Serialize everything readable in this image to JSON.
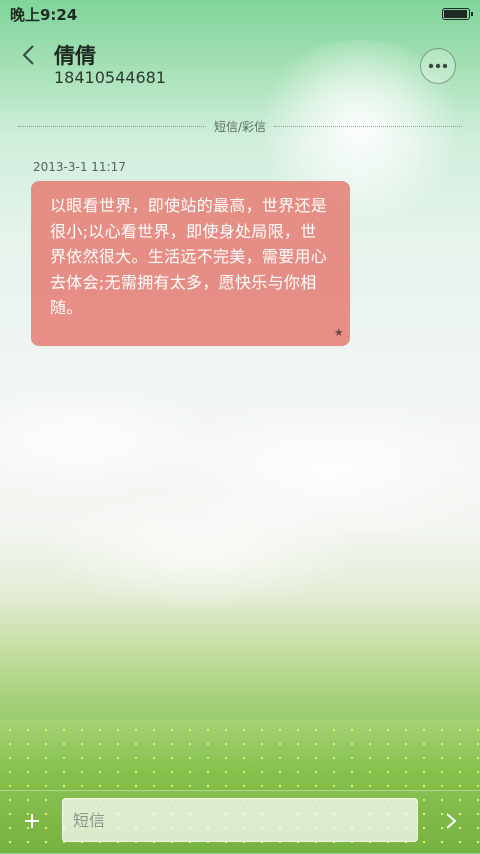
{
  "status_bar": {
    "time": "晚上9:24",
    "battery_level": 1.0
  },
  "header": {
    "contact_name": "倩倩",
    "contact_number": "18410544681"
  },
  "thread": {
    "divider_label": "短信/彩信",
    "messages": [
      {
        "timestamp": "2013-3-1 11:17",
        "text": "以眼看世界，即使站的最高，世界还是很小;以心看世界，即使身处局限，世界依然很大。生活远不完美，需要用心去体会;无需拥有太多，愿快乐与你相随。",
        "starred": true,
        "star_symbol": "★"
      }
    ]
  },
  "input_bar": {
    "placeholder": "短信",
    "value": ""
  },
  "colors": {
    "bubble": "#e5786e",
    "text_dark": "#1e2a22",
    "accent_green": "#7fd49a"
  },
  "icons": {
    "back": "chevron-left-icon",
    "more": "more-dots-icon",
    "add": "plus-icon",
    "send": "send-arrow-icon",
    "star": "star-icon"
  }
}
